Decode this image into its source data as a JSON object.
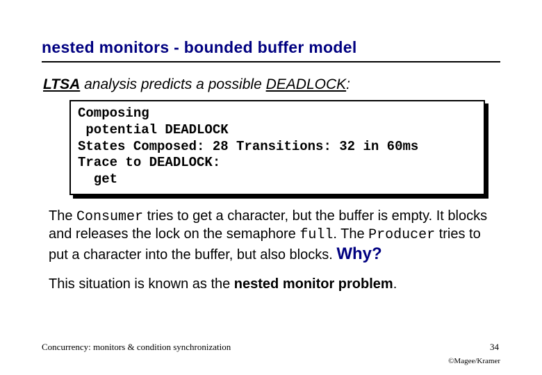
{
  "title": "nested monitors -  bounded buffer model",
  "predict": {
    "ltsa": "LTSA",
    "middle": " analysis predicts a possible ",
    "deadlock": "DEADLOCK",
    "after": ":"
  },
  "code": {
    "l1": "Composing",
    "l2": " potential DEADLOCK",
    "l3": "States Composed: 28 Transitions: 32 in 60ms",
    "l4": "Trace to DEADLOCK:",
    "l5": "  get"
  },
  "para1": {
    "t1": "The ",
    "consumer": "Consumer",
    "t2": " tries to get a character, but the buffer is empty. It blocks and releases the lock on the semaphore ",
    "full": "full",
    "t3": ". The ",
    "producer": "Producer",
    "t4": " tries to put a character into the buffer, but also blocks. ",
    "why": "Why?"
  },
  "para2": {
    "t1": "This situation is known as the ",
    "nmp": "nested monitor problem",
    "t2": "."
  },
  "footer": {
    "left": "Concurrency: monitors & condition synchronization",
    "pagenum": "34",
    "copy": "©Magee/Kramer"
  }
}
